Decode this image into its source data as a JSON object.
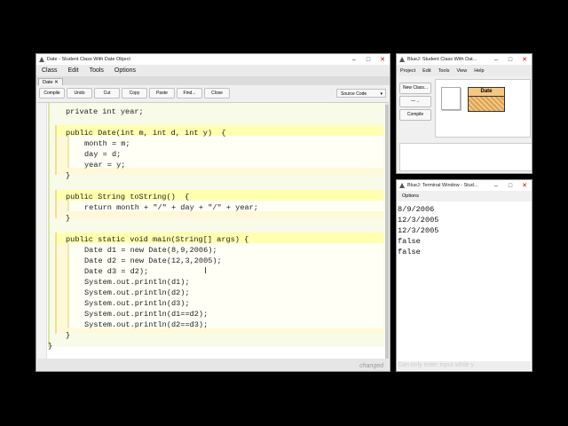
{
  "editor": {
    "title": "Date - Student Class With Date Object",
    "menu": [
      "Class",
      "Edit",
      "Tools",
      "Options"
    ],
    "tab": "Date",
    "toolbar": [
      "Compile",
      "Undo",
      "Cut",
      "Copy",
      "Paste",
      "Find...",
      "Close"
    ],
    "view_select": "Source Code",
    "code": {
      "l1": "private int year;",
      "c1_head": "public Date(int m, int d, int y)  {",
      "c1_b1": "month = m;",
      "c1_b2": "day = d;",
      "c1_b3": "year = y;",
      "c1_end": "}",
      "m1_head": "public String toString()  {",
      "m1_b1": "return month + \"/\" + day + \"/\" + year;",
      "m1_end": "}",
      "m2_head": "public static void main(String[] args) {",
      "m2_b1": "Date d1 = new Date(8,9,2006);",
      "m2_b2": "Date d2 = new Date(12,3,2005);",
      "m2_b3": "Date d3 = d2);",
      "m2_b4": "System.out.println(d1);",
      "m2_b5": "System.out.println(d2);",
      "m2_b6": "System.out.println(d3);",
      "m2_b7": "System.out.println(d1==d2);",
      "m2_b8": "System.out.println(d2==d3);",
      "m2_end": "}",
      "cls_end": "}"
    },
    "status": "changed"
  },
  "bluej": {
    "title": "BlueJ: Student Class With Dat...",
    "menu": [
      "Project",
      "Edit",
      "Tools",
      "View",
      "Help"
    ],
    "buttons": [
      "New Class...",
      "—→",
      "Compile"
    ],
    "class_name": "Date"
  },
  "terminal": {
    "title": "BlueJ: Terminal Window - Stud...",
    "menu": "Options",
    "output": [
      "8/9/2006",
      "12/3/2005",
      "12/3/2005",
      "false",
      "false"
    ],
    "input_hint": "Can only enter input while y"
  }
}
